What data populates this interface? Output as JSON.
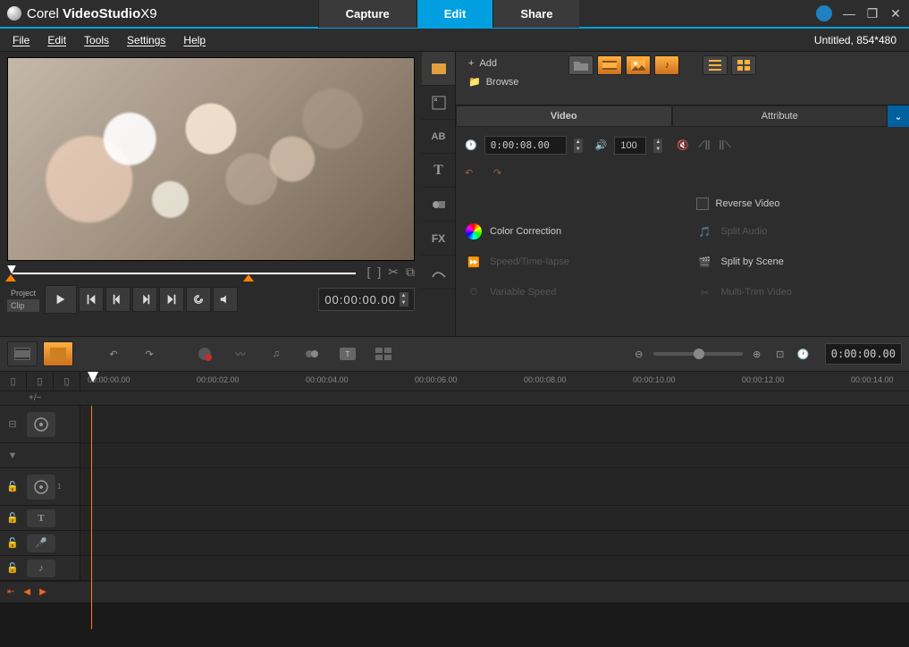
{
  "app": {
    "brand": "Corel",
    "name": "VideoStudio",
    "version": "X9"
  },
  "main_tabs": [
    "Capture",
    "Edit",
    "Share"
  ],
  "main_tab_active": 1,
  "menu": [
    "File",
    "Edit",
    "Tools",
    "Settings",
    "Help"
  ],
  "project_info": "Untitled, 854*480",
  "playback": {
    "labels": [
      "Project",
      "Clip"
    ],
    "active_label": 1,
    "timecode": "00:00:00.00"
  },
  "library": {
    "actions": {
      "add": "Add",
      "browse": "Browse"
    },
    "tabs": [
      "Video",
      "Attribute"
    ],
    "tab_active": 0
  },
  "video_options": {
    "duration": "0:00:08.00",
    "volume": "100",
    "reverse": "Reverse Video",
    "color_correction": "Color Correction",
    "speed_timelapse": "Speed/Time-lapse",
    "variable_speed": "Variable Speed",
    "split_audio": "Split Audio",
    "split_scene": "Split by Scene",
    "multi_trim": "Multi-Trim Video"
  },
  "timeline": {
    "timecode": "0:00:00.00",
    "ticks": [
      "00:00:00.00",
      "00:00:02.00",
      "00:00:04.00",
      "00:00:06.00",
      "00:00:08.00",
      "00:00:10.00",
      "00:00:12.00",
      "00:00:14.00"
    ],
    "addrow": "+/−"
  }
}
